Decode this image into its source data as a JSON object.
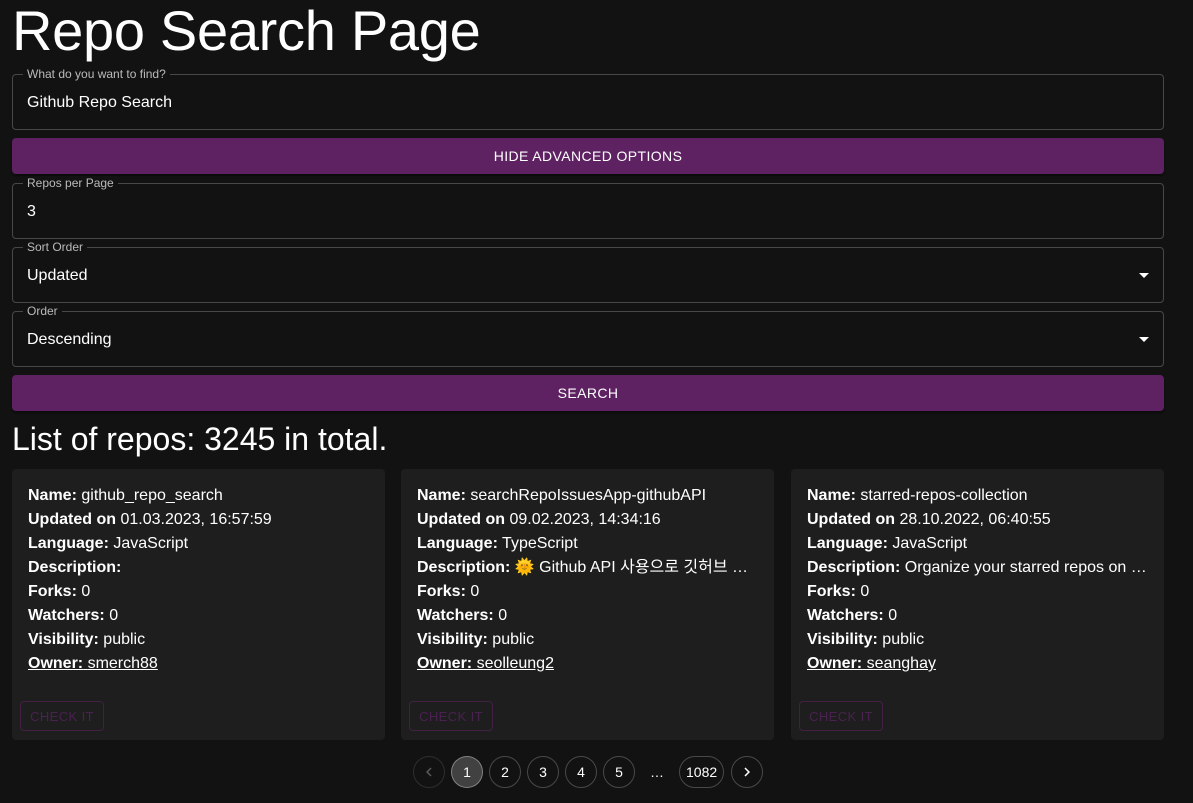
{
  "page": {
    "title": "Repo Search Page"
  },
  "search": {
    "label": "What do you want to find?",
    "value": "Github Repo Search"
  },
  "advanced_toggle_label": "HIDE ADVANCED OPTIONS",
  "options": {
    "per_page": {
      "label": "Repos per Page",
      "value": "3"
    },
    "sort": {
      "label": "Sort Order",
      "value": "Updated"
    },
    "order": {
      "label": "Order",
      "value": "Descending"
    }
  },
  "search_button_label": "SEARCH",
  "list": {
    "heading": "List of repos: 3245 in total."
  },
  "field_labels": {
    "name": "Name:",
    "updated": "Updated on",
    "language": "Language:",
    "description": "Description:",
    "forks": "Forks:",
    "watchers": "Watchers:",
    "visibility": "Visibility:",
    "owner": "Owner:"
  },
  "repos": [
    {
      "name": "github_repo_search",
      "updated": "01.03.2023, 16:57:59",
      "language": "JavaScript",
      "description": "",
      "forks": "0",
      "watchers": "0",
      "visibility": "public",
      "owner": "smerch88",
      "button": "CHECK IT"
    },
    {
      "name": "searchRepoIssuesApp-githubAPI",
      "updated": "09.02.2023, 14:34:16",
      "language": "TypeScript",
      "description": "🌞 Github API 사용으로 깃허브 레포지토리 이슈 검색",
      "forks": "0",
      "watchers": "0",
      "visibility": "public",
      "owner": "seolleung2",
      "button": "CHECK IT"
    },
    {
      "name": "starred-repos-collection",
      "updated": "28.10.2022, 06:40:55",
      "language": "JavaScript",
      "description": "Organize your starred repos on GitHub",
      "forks": "0",
      "watchers": "0",
      "visibility": "public",
      "owner": "seanghay",
      "button": "CHECK IT"
    }
  ],
  "pagination": {
    "pages": [
      "1",
      "2",
      "3",
      "4",
      "5"
    ],
    "ellipsis": "…",
    "last": "1082",
    "current": "1"
  },
  "colors": {
    "background": "#121212",
    "card": "#1e1e1e",
    "accent": "#5e2262"
  }
}
